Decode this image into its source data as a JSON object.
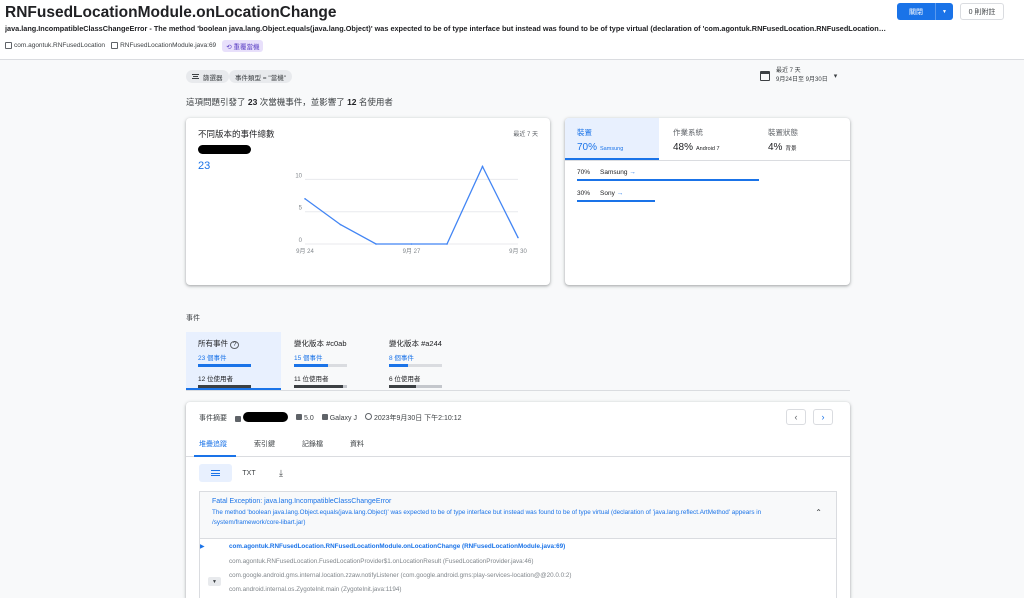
{
  "header": {
    "title": "RNFusedLocationModule.onLocationChange",
    "error_message": "java.lang.IncompatibleClassChangeError - The method 'boolean java.lang.Object.equals(java.lang.Object)' was expected to be of type interface but instead was found to be of type virtual (declaration of 'com.agontuk.RNFusedLocation.RNFusedLocationModule' appea…",
    "package": "com.agontuk.RNFusedLocation",
    "source_file": "RNFusedLocationModule.java:69",
    "badge": "重覆當機",
    "close_label": "關閉",
    "notes_label": "0 則附註"
  },
  "filters": {
    "filter_label": "篩選器",
    "event_type_chip": "事件類型 = \"當機\"",
    "date_line1": "最近 7 天",
    "date_line2": "9月24日至 9月30日"
  },
  "summary": {
    "prefix": "這項問題引發了 ",
    "events": "23",
    "mid": " 次當機事件，並影響了 ",
    "users": "12",
    "suffix": " 名使用者"
  },
  "version_card": {
    "title": "不同版本的事件總數",
    "range": "最近 7 天",
    "total": "23"
  },
  "chart_data": {
    "type": "line",
    "x": [
      "9月24",
      "9月25",
      "9月26",
      "9月27",
      "9月28",
      "9月29",
      "9月30"
    ],
    "x_tick_labels": [
      "9月 24",
      "9月 27",
      "9月 30"
    ],
    "series": [
      {
        "values": [
          7,
          3,
          0,
          0,
          0,
          12,
          1
        ]
      }
    ],
    "y_ticks": [
      0,
      5,
      10
    ],
    "ylim": [
      0,
      13
    ],
    "color": "#4285f4"
  },
  "device_card": {
    "tabs": [
      {
        "label": "裝置",
        "pct": "70%",
        "sub": "Samsung"
      },
      {
        "label": "作業系統",
        "pct": "48%",
        "sub": "Android 7"
      },
      {
        "label": "裝置狀態",
        "pct": "4%",
        "sub": "背景"
      }
    ],
    "rows": [
      {
        "pct": "70%",
        "name": "Samsung",
        "share": 0.7
      },
      {
        "pct": "30%",
        "name": "Sony",
        "share": 0.3
      }
    ],
    "arrow": "→"
  },
  "events": {
    "section_label": "事件",
    "tabs": [
      {
        "title": "所有事件",
        "count": "23 個事件",
        "users": "12 位使用者",
        "count_fill": 1.0,
        "user_fill": 1.0
      },
      {
        "title": "變化版本 #c0ab",
        "count": "15 個事件",
        "users": "11 位使用者",
        "count_fill": 0.65,
        "user_fill": 0.92
      },
      {
        "title": "變化版本 #a244",
        "count": "8 個事件",
        "users": "6 位使用者",
        "count_fill": 0.35,
        "user_fill": 0.5
      }
    ]
  },
  "event_detail": {
    "summary_label": "事件摘要",
    "version": "5.0",
    "device": "Galaxy J",
    "time": "2023年9月30日 下午2:10:12",
    "prev": "‹",
    "next": "›",
    "tabs": [
      "堆疊追蹤",
      "索引鍵",
      "記錄檔",
      "資料"
    ],
    "view_txt": "TXT",
    "download": "⤓"
  },
  "stacktrace": {
    "exception_title": "Fatal Exception: java.lang.IncompatibleClassChangeError",
    "exception_detail": "The method 'boolean java.lang.Object.equals(java.lang.Object)' was expected to be of type interface but instead was found to be of type virtual (declaration of 'java.lang.reflect.ArtMethod' appears in /system/framework/core-libart.jar)",
    "collapse": "⌃",
    "frames": [
      "com.agontuk.RNFusedLocation.RNFusedLocationModule.onLocationChange (RNFusedLocationModule.java:69)",
      "com.agontuk.RNFusedLocation.FusedLocationProvider$1.onLocationResult (FusedLocationProvider.java:46)",
      "com.google.android.gms.internal.location.zzaw.notifyListener (com.google.android.gms:play-services-location@@20.0.0:2)",
      "com.android.internal.os.ZygoteInit.main (ZygoteInit.java:1194)"
    ],
    "marker": "▶",
    "expand": "▼"
  }
}
